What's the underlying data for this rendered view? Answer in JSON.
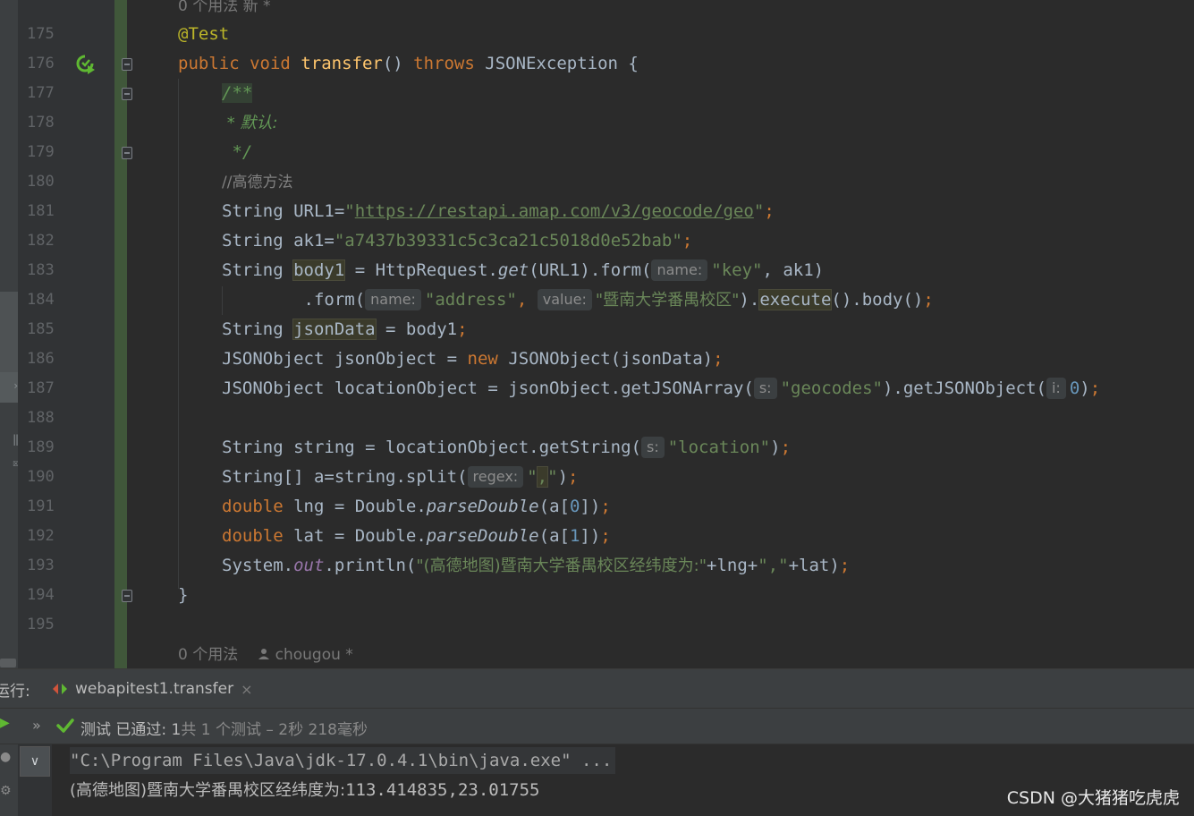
{
  "editor": {
    "usage_top": "0 个用法   新 *",
    "usage_bottom_count": "0 个用法",
    "usage_bottom_author": "chougou *",
    "line_numbers": [
      "175",
      "176",
      "177",
      "178",
      "179",
      "180",
      "181",
      "182",
      "183",
      "184",
      "185",
      "186",
      "187",
      "188",
      "189",
      "190",
      "191",
      "192",
      "193",
      "194",
      "195"
    ],
    "code": {
      "annotation": "@Test",
      "kw_public": "public",
      "kw_void": "void",
      "method_name": "transfer",
      "paren_open_close": "()",
      "kw_throws": "throws",
      "exception": "JSONException {",
      "doc_start": "/**",
      "doc_default": " * 默认:",
      "doc_end": " */",
      "line_comment": "//高德方法",
      "url_decl": "String URL1=",
      "url_q1": "\"",
      "url_link": "https://restapi.amap.com/v3/geocode/geo",
      "url_q2": "\"",
      "semi": ";",
      "ak_decl": "String ak1=",
      "ak_value": "\"a7437b39331c5c3ca21c5018d0e52bab\"",
      "body_type": "String ",
      "body_var": "body1",
      "body_rest1": " = HttpRequest.",
      "body_get": "get",
      "body_rest2": "(URL1).form(",
      "hint_name": "name:",
      "str_key": "\"key\"",
      "body_rest3": ", ak1)",
      "form2_pre": "        .form(",
      "str_address": "\"address\"",
      "comma_space": ", ",
      "hint_value": "value:",
      "str_campus": "\"暨南大学番禺校区\"",
      "form2_close": ").",
      "execute": "execute",
      "form2_end": "().body()",
      "json_type": "String ",
      "json_var": "jsonData",
      "json_rest": " = body1",
      "jo_decl": "JSONObject jsonObject = ",
      "kw_new": "new",
      "jo_rest": " JSONObject(jsonData)",
      "loc_decl": "JSONObject locationObject = jsonObject.getJSONArray(",
      "hint_s": "s:",
      "str_geocodes": "\"geocodes\"",
      "loc_mid": ").getJSONObject(",
      "hint_i": "i:",
      "num_0": "0",
      "close_paren": ")",
      "str_decl": "String string = locationObject.getString(",
      "str_location": "\"location\"",
      "split_decl": "String[] a=string.split(",
      "hint_regex": "regex:",
      "str_comma_q1": "\"",
      "str_comma": ",",
      "str_comma_q2": "\"",
      "kw_double": "double",
      "lng_decl": " lng = Double.",
      "parse": "parseDouble",
      "a_open": "(a[",
      "num_1": "1",
      "a_close": "])",
      "lat_decl": " lat = Double.",
      "sys": "System.",
      "out": "out",
      "println": ".println(",
      "str_msg": "\"(高德地图)暨南大学番禺校区经纬度为:\"",
      "print_rest": "+lng+",
      "str_sep": "\",\"",
      "print_end": "+lat)",
      "close_brace": "}"
    }
  },
  "run_panel": {
    "label": "运行:",
    "tab_label": "webapitest1.transfer",
    "tab_close": "×",
    "expand": "»",
    "status_prefix": "测试 已通过: 1",
    "status_rest": "共 1 个测试 – 2秒 218毫秒",
    "console_toggle": "∨",
    "console_cmd": "\"C:\\Program Files\\Java\\jdk-17.0.4.1\\bin\\java.exe\" ...",
    "console_out_label": "(高德地图)暨南大学番禺校区经纬度为:",
    "console_out_value": "113.414835,23.01755"
  },
  "watermark": "CSDN @大猪猪吃虎虎",
  "colors": {
    "background": "#2b2b2b",
    "keyword": "#cc7832",
    "string": "#6a8759",
    "method": "#ffc66d",
    "annotation": "#bbb529",
    "number": "#6897bb",
    "pass_green": "#5fb832"
  },
  "icons": {
    "run_gutter": "run-test-icon",
    "tab": "junit-tab-icon",
    "pass": "check-icon"
  }
}
